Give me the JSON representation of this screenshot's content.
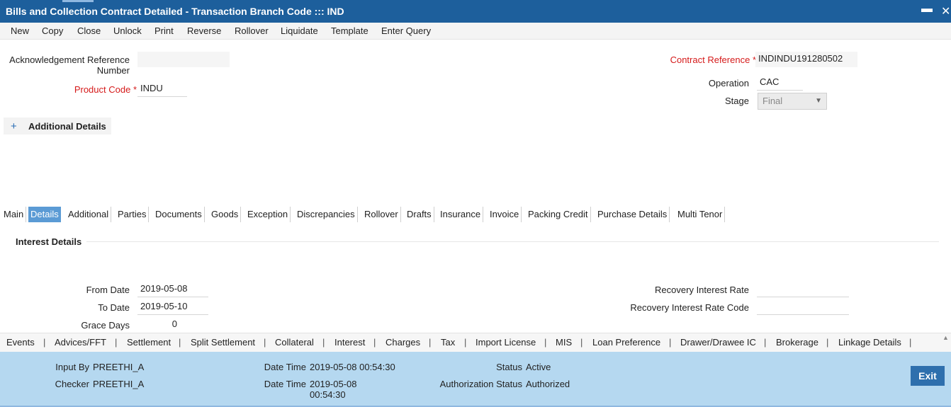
{
  "window": {
    "title": "Bills and Collection Contract Detailed - Transaction Branch Code ::: IND",
    "minimize": "▬",
    "close": "✕"
  },
  "toolbar": [
    "New",
    "Copy",
    "Close",
    "Unlock",
    "Print",
    "Reverse",
    "Rollover",
    "Liquidate",
    "Template",
    "Enter Query"
  ],
  "header": {
    "ack_ref_label": "Acknowledgement Reference Number",
    "ack_ref_label_line1": "Acknowledgement Reference",
    "ack_ref_label_line2": "Number",
    "ack_ref_value": "",
    "product_code_label": "Product Code",
    "product_code_value": "INDU",
    "contract_ref_label": "Contract Reference",
    "contract_ref_value": "INDINDU191280502",
    "operation_label": "Operation",
    "operation_value": "CAC",
    "stage_label": "Stage",
    "stage_value": "Final",
    "required_star": "*"
  },
  "additional_details": {
    "toggle": "+",
    "label": "Additional Details"
  },
  "tabs": [
    "Main",
    "Details",
    "Additional",
    "Parties",
    "Documents",
    "Goods",
    "Exception",
    "Discrepancies",
    "Rollover",
    "Drafts",
    "Insurance",
    "Invoice",
    "Packing Credit",
    "Purchase Details",
    "Multi Tenor"
  ],
  "active_tab": "Details",
  "interest": {
    "section_title": "Interest Details",
    "from_date_label": "From Date",
    "from_date_value": "2019-05-08",
    "to_date_label": "To Date",
    "to_date_value": "2019-05-10",
    "grace_days_label": "Grace Days",
    "grace_days_value": "0",
    "recovery_rate_label": "Recovery Interest Rate",
    "recovery_rate_value": "",
    "recovery_rate_code_label": "Recovery Interest Rate Code",
    "recovery_rate_code_value": ""
  },
  "bottom_links": [
    "Events",
    "Advices/FFT",
    "Settlement",
    "Split Settlement",
    "Collateral",
    "Interest",
    "Charges",
    "Tax",
    "Import License",
    "MIS",
    "Loan Preference",
    "Drawer/Drawee IC",
    "Brokerage",
    "Linkage Details"
  ],
  "link_separator": "|",
  "audit": {
    "input_by_label": "Input By",
    "input_by_value": "PREETHI_A",
    "checker_label": "Checker",
    "checker_value": "PREETHI_A",
    "date_time_label": "Date Time",
    "input_date_time": "2019-05-08 00:54:30",
    "checker_date_time_line1": "2019-05-08",
    "checker_date_time_line2": "00:54:30",
    "status_label": "Status",
    "status_value": "Active",
    "auth_status_label": "Authorization Status",
    "auth_status_value": "Authorized",
    "exit_label": "Exit"
  },
  "colors": {
    "titlebar": "#1d5f9c",
    "active_tab": "#5b9bd5",
    "required": "#d51a1a",
    "audit_bg": "#b5d8f0",
    "exit_button": "#2e6fad"
  }
}
